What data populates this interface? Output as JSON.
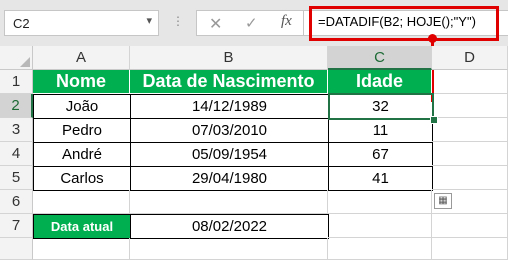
{
  "name_box": {
    "value": "C2"
  },
  "formula": {
    "text": "=DATADIF(B2; HOJE();\"Y\")"
  },
  "icons": {
    "dropdown": "chevron-down-icon",
    "cancel": "cancel-x-icon",
    "enter": "check-icon",
    "fx": "fx-icon",
    "paste_options": "paste-options-icon"
  },
  "colors": {
    "green": "#00b050",
    "red": "#e00000",
    "selection": "#217346"
  },
  "columns": [
    "A",
    "B",
    "C",
    "D"
  ],
  "rows": [
    "1",
    "2",
    "3",
    "4",
    "5",
    "6",
    "7"
  ],
  "table": {
    "headers": [
      "Nome",
      "Data de Nascimento",
      "Idade"
    ],
    "data": [
      [
        "João",
        "14/12/1989",
        "32"
      ],
      [
        "Pedro",
        "07/03/2010",
        "11"
      ],
      [
        "André",
        "05/09/1954",
        "67"
      ],
      [
        "Carlos",
        "29/04/1980",
        "41"
      ]
    ]
  },
  "current_date": {
    "label": "Data atual",
    "value": "08/02/2022"
  },
  "selected_cell": "C2"
}
